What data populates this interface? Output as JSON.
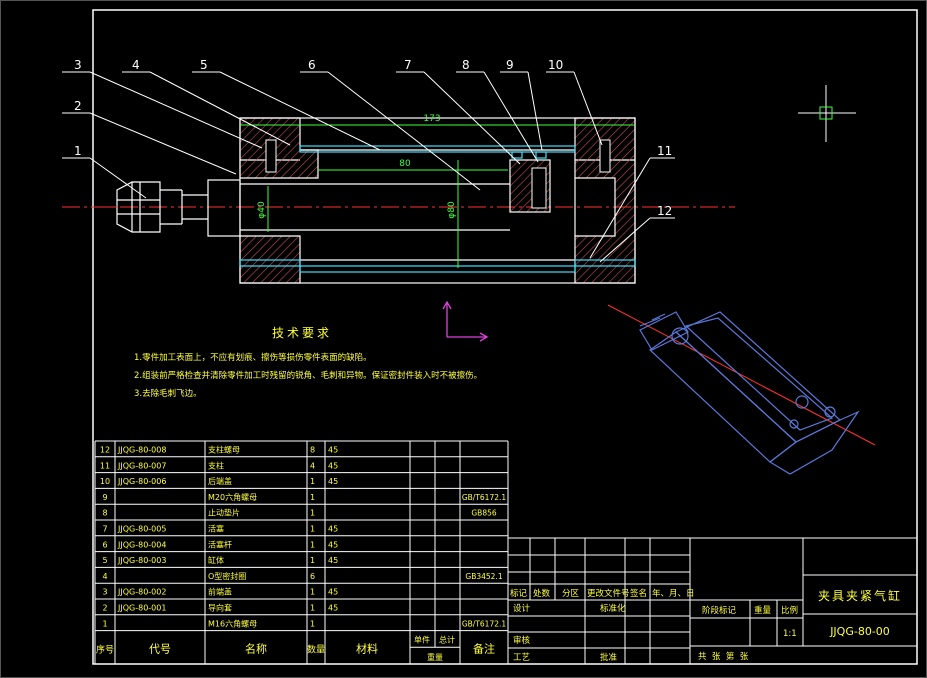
{
  "callouts": [
    "1",
    "2",
    "3",
    "4",
    "5",
    "6",
    "7",
    "8",
    "9",
    "10",
    "11",
    "12"
  ],
  "dimensions": {
    "overall_length": "173",
    "stroke": "80",
    "dia_small": "φ40",
    "dia_large": "φ80"
  },
  "tech_requirements": {
    "title": "技术要求",
    "lines": [
      "1.零件加工表面上，不应有划痕、擦伤等损伤零件表面的缺陷。",
      "2.组装前严格检查并清除零件加工时残留的锐角、毛刺和异物。保证密封件装入时不被擦伤。",
      "3.去除毛刺飞边。"
    ]
  },
  "bom": {
    "headers": [
      "序号",
      "代号",
      "名称",
      "数量",
      "材料",
      "单件",
      "总计",
      "重量",
      "备注"
    ],
    "rows": [
      {
        "no": "12",
        "code": "JJQG-80-008",
        "name": "支柱螺母",
        "qty": "8",
        "mat": "45",
        "note": ""
      },
      {
        "no": "11",
        "code": "JJQG-80-007",
        "name": "支柱",
        "qty": "4",
        "mat": "45",
        "note": ""
      },
      {
        "no": "10",
        "code": "JJQG-80-006",
        "name": "后端盖",
        "qty": "1",
        "mat": "45",
        "note": ""
      },
      {
        "no": "9",
        "code": "",
        "name": "M20六角螺母",
        "qty": "1",
        "mat": "",
        "note": "GB/T6172.1"
      },
      {
        "no": "8",
        "code": "",
        "name": "止动垫片",
        "qty": "1",
        "mat": "",
        "note": "GB856"
      },
      {
        "no": "7",
        "code": "JJQG-80-005",
        "name": "活塞",
        "qty": "1",
        "mat": "45",
        "note": ""
      },
      {
        "no": "6",
        "code": "JJQG-80-004",
        "name": "活塞杆",
        "qty": "1",
        "mat": "45",
        "note": ""
      },
      {
        "no": "5",
        "code": "JJQG-80-003",
        "name": "缸体",
        "qty": "1",
        "mat": "45",
        "note": ""
      },
      {
        "no": "4",
        "code": "",
        "name": "O型密封圈",
        "qty": "6",
        "mat": "",
        "note": "GB3452.1"
      },
      {
        "no": "3",
        "code": "JJQG-80-002",
        "name": "前端盖",
        "qty": "1",
        "mat": "45",
        "note": ""
      },
      {
        "no": "2",
        "code": "JJQG-80-001",
        "name": "导向套",
        "qty": "1",
        "mat": "45",
        "note": ""
      },
      {
        "no": "1",
        "code": "",
        "name": "M16六角螺母",
        "qty": "1",
        "mat": "",
        "note": "GB/T6172.1"
      }
    ]
  },
  "title_block": {
    "rev_labels": [
      "标记",
      "处数",
      "分区",
      "更改文件号",
      "签名",
      "年、月、日"
    ],
    "role_labels": [
      "设计",
      "标准化",
      "审核",
      "工艺",
      "批准"
    ],
    "stage_label": "阶段标记",
    "weight_label": "重量",
    "scale_label": "比例",
    "scale_value": "1:1",
    "sheet_label": "共  张  第  张",
    "drawing_title": "夹具夹紧气缸",
    "drawing_number": "JJQG-80-00"
  },
  "colors": {
    "frame": "#ffffff",
    "part": "#ffffff",
    "hatch": "#c05050",
    "centerline": "#ff3030",
    "seal": "#40e0ff",
    "dimension": "#40ff40",
    "text": "#ffff40",
    "iso_view": "#5a78d8",
    "ucs": "#e040e0"
  }
}
